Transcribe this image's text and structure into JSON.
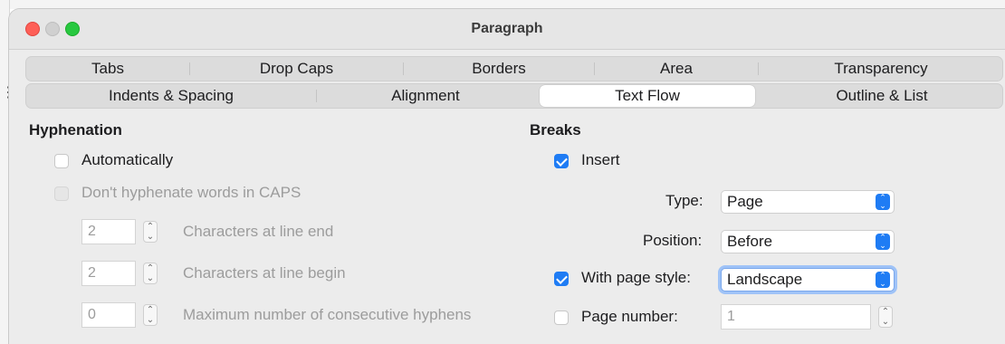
{
  "window": {
    "title": "Paragraph"
  },
  "tabs": {
    "row1": [
      "Tabs",
      "Drop Caps",
      "Borders",
      "Area",
      "Transparency"
    ],
    "row2": [
      "Indents & Spacing",
      "Alignment",
      "Text Flow",
      "Outline & List"
    ],
    "active": "Text Flow"
  },
  "hyphenation": {
    "title": "Hyphenation",
    "automatically": {
      "label": "Automatically",
      "checked": false
    },
    "dont_caps": {
      "label": "Don't hyphenate words in CAPS",
      "checked": false,
      "disabled": true
    },
    "chars_line_end": {
      "value": "2",
      "label": "Characters at line end"
    },
    "chars_line_begin": {
      "value": "2",
      "label": "Characters at line begin"
    },
    "max_hyphens": {
      "value": "0",
      "label": "Maximum number of consecutive hyphens"
    }
  },
  "breaks": {
    "title": "Breaks",
    "insert": {
      "label": "Insert",
      "checked": true
    },
    "type": {
      "label": "Type:",
      "value": "Page"
    },
    "position": {
      "label": "Position:",
      "value": "Before"
    },
    "page_style": {
      "label": "With page style:",
      "checked": true,
      "value": "Landscape"
    },
    "page_number": {
      "label": "Page number:",
      "checked": false,
      "value": "1"
    }
  },
  "colors": {
    "accent": "#1f7cf4",
    "focus_ring": "#9fc3f7"
  },
  "icons": {
    "close": "close-icon",
    "minimize": "minimize-icon",
    "zoom": "zoom-icon",
    "spinner": "stepper-icon",
    "select": "chevron-updown-icon"
  }
}
